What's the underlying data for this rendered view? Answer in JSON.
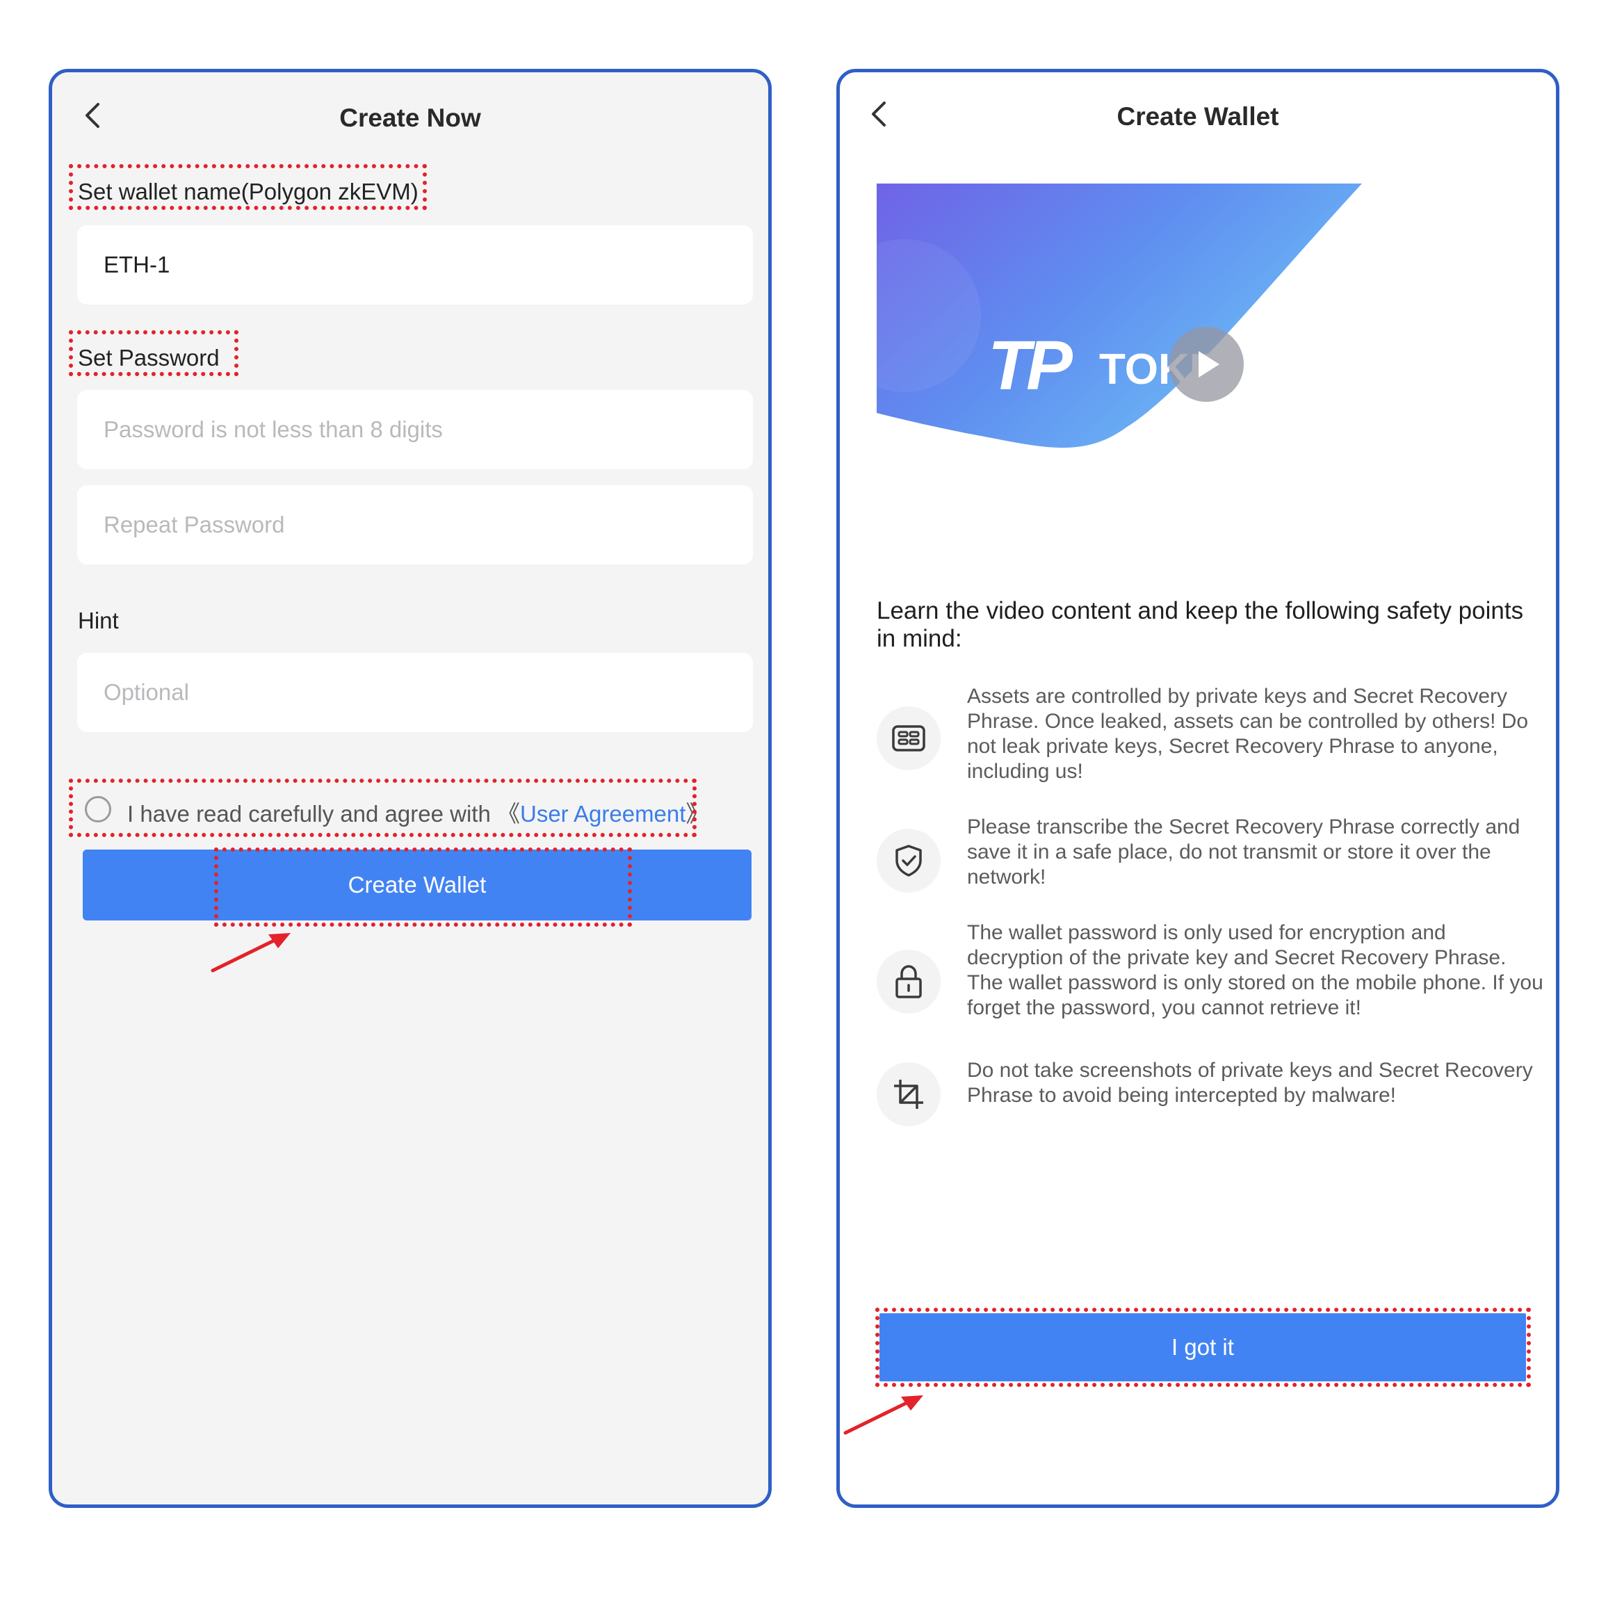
{
  "left_screen": {
    "title": "Create Now",
    "wallet_name_label": "Set wallet name(Polygon zkEVM)",
    "wallet_name_value": "ETH-1",
    "password_label": "Set Password",
    "password_placeholder": "Password is not less than 8 digits",
    "repeat_placeholder": "Repeat Password",
    "hint_label": "Hint",
    "hint_placeholder": "Optional",
    "agree_text": "I have read carefully and agree with ",
    "agree_open": "《",
    "agree_link": "User Agreement",
    "agree_close": "》",
    "create_button": "Create Wallet"
  },
  "right_screen": {
    "title": "Create Wallet",
    "banner_logo_mark": "TP",
    "banner_logo_text": "TOKEN POCKET",
    "lead": "Learn the video content and keep the following safety points in mind:",
    "points": [
      {
        "icon": "keys-card-icon",
        "text": "Assets are controlled by private keys and Secret Recovery Phrase. Once leaked, assets can be controlled by others! Do not leak private keys, Secret Recovery Phrase to anyone, including us!"
      },
      {
        "icon": "shield-check-icon",
        "text": "Please transcribe the Secret Recovery Phrase correctly and save it in a safe place, do not transmit or store it over the network!"
      },
      {
        "icon": "lock-icon",
        "text": "The wallet password is only used for encryption and decryption of the private key and Secret Recovery Phrase. The wallet password is only stored on the mobile phone. If you forget the password, you cannot retrieve it!"
      },
      {
        "icon": "crop-icon",
        "text": "Do not take screenshots of private keys and Secret Recovery Phrase to avoid being intercepted by malware!"
      }
    ],
    "confirm_button": "I got it"
  },
  "colors": {
    "frame": "#2f5fc6",
    "button": "#4283f3",
    "highlight": "#e3222a",
    "link": "#3b7de9"
  }
}
